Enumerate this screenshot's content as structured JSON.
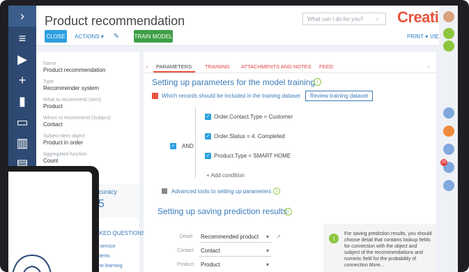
{
  "app": {
    "title": "Product recommendation",
    "logo": "Creatio"
  },
  "toolbar": {
    "close": "CLOSE",
    "actions": "ACTIONS ▾",
    "train": "TRAIN MODEL",
    "print": "PRINT ▾",
    "view": "VIEW ▾"
  },
  "search": {
    "placeholder": "What can I do for you?"
  },
  "left": {
    "fields": [
      {
        "label": "Name",
        "value": "Product recommendation"
      },
      {
        "label": "Type",
        "value": "Recommender system"
      },
      {
        "label": "What to recommend (Item)",
        "value": "Product"
      },
      {
        "label": "Whom to recommend (Subject)",
        "value": "Contact"
      },
      {
        "label": "Subject-item object",
        "value": "Product in order"
      },
      {
        "label": "Aggregated function",
        "value": "Count"
      }
    ],
    "accuracy_label": "accuracy",
    "accuracy_value": "05",
    "faq_title": "ASKED QUESTIONS",
    "faq_items": [
      "ing service",
      "systems",
      "chine learning"
    ]
  },
  "tabs": [
    "PARAMETERS",
    "TRAINING",
    "ATTACHMENTS AND NOTES",
    "FEED"
  ],
  "params": {
    "heading": "Setting up parameters for the model training",
    "which": "Which records should be included in the training  dataset",
    "review": "Review training dataset",
    "and": "AND",
    "conditions": [
      "Order.Contact.Type  =  Customer",
      "Order.Status  =   4. Completed",
      "Product.Type  =   SMART HOME"
    ],
    "add": "+ Add condition",
    "advanced": "Advanced tools to setting up parameters"
  },
  "save": {
    "heading": "Setting up saving prediction results",
    "rows": [
      {
        "label": "Detail",
        "value": "Recommended product"
      },
      {
        "label": "Contact",
        "value": "Contact"
      },
      {
        "label": "Product",
        "value": "Product"
      }
    ],
    "info": "For saving prediction results, you should choose detail that contains lookup fields for connection with the object and subject of the recommendations and numeric field for the probability of connection More..."
  },
  "notification_count": "20"
}
